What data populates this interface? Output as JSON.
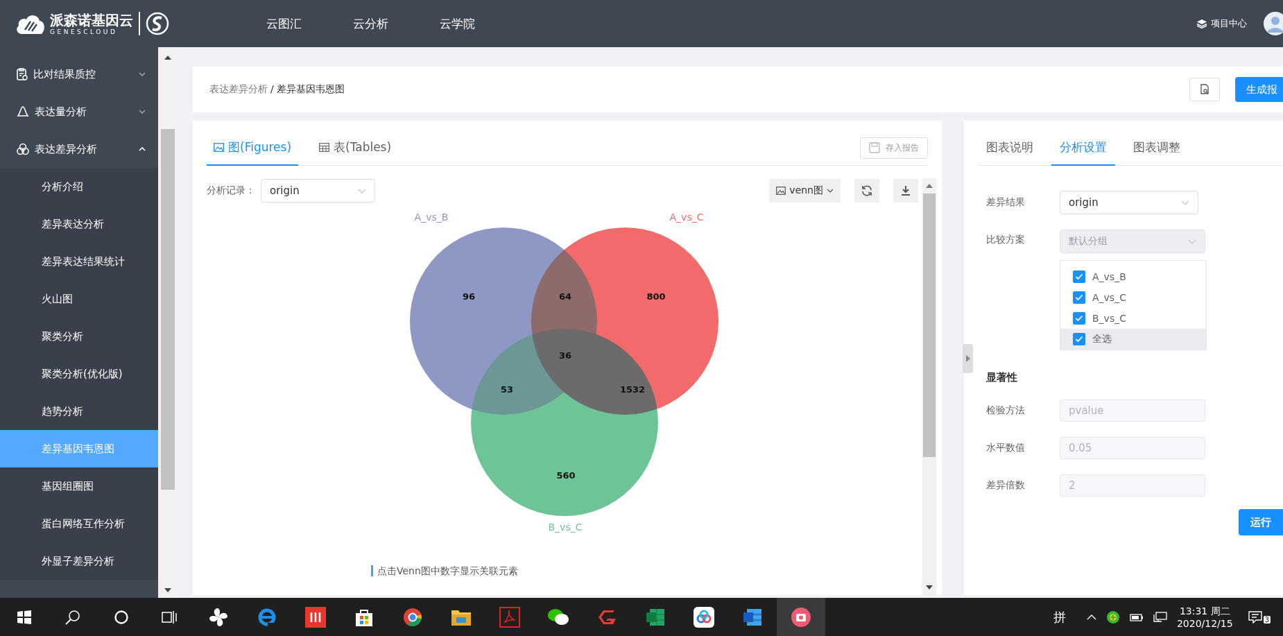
{
  "header": {
    "logo_text": "派森诺基因云",
    "logo_subtext": "GENESCLOUD",
    "nav": [
      {
        "label": "云图汇"
      },
      {
        "label": "云分析"
      },
      {
        "label": "云学院"
      }
    ],
    "project_center": "项目中心"
  },
  "sidebar": {
    "items": [
      {
        "label": "比对结果质控",
        "kind": "clipboard",
        "expanded": false
      },
      {
        "label": "表达量分析",
        "kind": "bell",
        "expanded": false
      },
      {
        "label": "表达差异分析",
        "kind": "circles",
        "expanded": true,
        "children": [
          {
            "label": "分析介绍",
            "selected": false
          },
          {
            "label": "差异表达分析",
            "selected": false
          },
          {
            "label": "差异表达结果统计",
            "selected": false
          },
          {
            "label": "火山图",
            "selected": false
          },
          {
            "label": "聚类分析",
            "selected": false
          },
          {
            "label": "聚类分析(优化版)",
            "selected": false
          },
          {
            "label": "趋势分析",
            "selected": false
          },
          {
            "label": "差异基因韦恩图",
            "selected": true
          },
          {
            "label": "基因组圈图",
            "selected": false
          },
          {
            "label": "蛋白网络互作分析",
            "selected": false
          },
          {
            "label": "外显子差异分析",
            "selected": false
          }
        ]
      }
    ]
  },
  "breadcrumb": {
    "parent": "表达差异分析",
    "separator": "/",
    "current": "差异基因韦恩图"
  },
  "generate_button": "生成报",
  "figure_panel": {
    "tabs": [
      {
        "label": "图(Figures)",
        "kind": "image",
        "selected": true
      },
      {
        "label": "表(Tables)",
        "kind": "table",
        "selected": false
      }
    ],
    "save_button": "存入报告",
    "record_label": "分析记录：",
    "record_value": "origin",
    "chart_type": "venn图",
    "venn": {
      "sets": [
        {
          "label": "A_vs_B",
          "color": "#8f97c4"
        },
        {
          "label": "A_vs_C",
          "color": "#f26a6a"
        },
        {
          "label": "B_vs_C",
          "color": "#6cc497"
        }
      ],
      "counts": [
        "96",
        "64",
        "800",
        "36",
        "53",
        "1532",
        "560"
      ]
    },
    "hint": "点击Venn图中数字显示关联元素"
  },
  "settings_panel": {
    "tabs": [
      {
        "label": "图表说明",
        "selected": false
      },
      {
        "label": "分析设置",
        "selected": true
      },
      {
        "label": "图表调整",
        "selected": false
      }
    ],
    "diff_result": {
      "label": "差异结果",
      "value": "origin"
    },
    "scheme": {
      "label": "比较方案",
      "placeholder": "默认分组",
      "disabled": true
    },
    "options": [
      {
        "label": "A_vs_B",
        "checked": true,
        "hovered": false
      },
      {
        "label": "A_vs_C",
        "checked": true,
        "hovered": false
      },
      {
        "label": "B_vs_C",
        "checked": true,
        "hovered": false
      },
      {
        "label": "全选",
        "checked": true,
        "hovered": true
      }
    ],
    "section": "显著性",
    "fields": [
      {
        "label": "检验方法",
        "value": "pvalue"
      },
      {
        "label": "水平数值",
        "value": "0.05"
      },
      {
        "label": "差异倍数",
        "value": "2"
      }
    ],
    "run_button": "运行"
  },
  "taskbar": {
    "ime": "拼",
    "time": "13:31 周二",
    "date": "2020/12/15",
    "notifications": "3"
  }
}
